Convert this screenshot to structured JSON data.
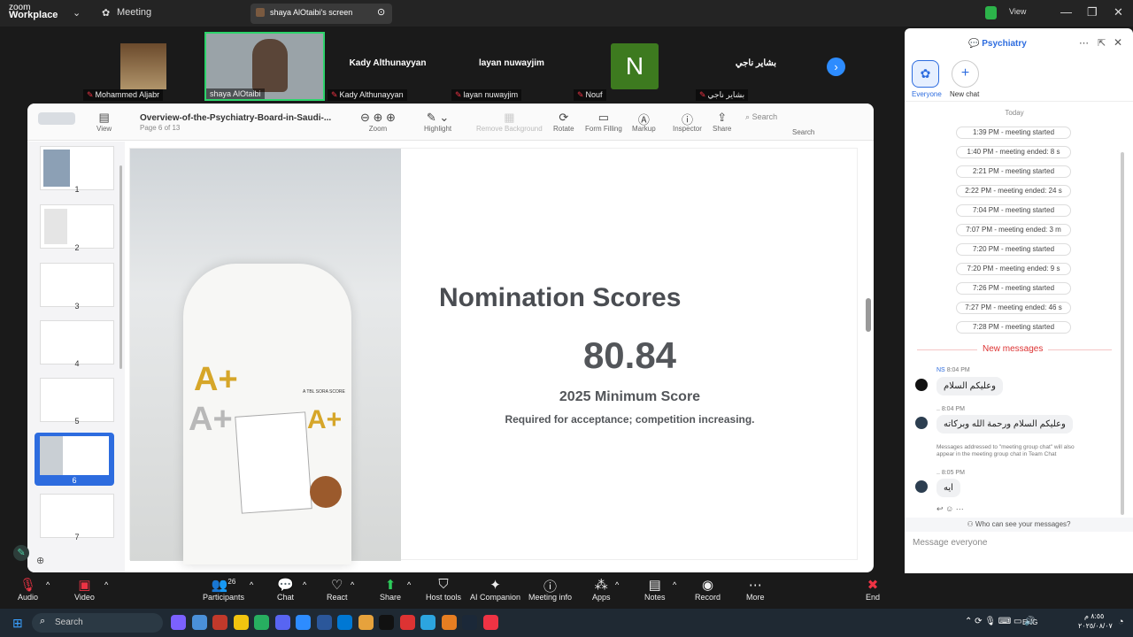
{
  "topbar": {
    "logo_top": "zoom",
    "logo_bottom": "Workplace",
    "meeting": "Meeting",
    "screen_tab": "shaya AlOtaibi's screen",
    "view": "View"
  },
  "gallery": {
    "tiles": [
      {
        "name": "Mohammed Aljabr"
      },
      {
        "name": "shaya AlOtaibi"
      },
      {
        "name": "Kady Althunayyan",
        "label": "Kady Althunayyan"
      },
      {
        "name": "layan nuwayjim",
        "label": "layan nuwayjim"
      },
      {
        "name": "Nouf",
        "initial": "N"
      },
      {
        "name": "بشاير ناجي",
        "label": "بشاير ناجي"
      }
    ]
  },
  "viewer": {
    "doc_title": "Overview-of-the-Psychiatry-Board-in-Saudi-...",
    "page_info": "Page 6 of 13",
    "tools": {
      "view": "View",
      "zoom": "Zoom",
      "highlight": "Highlight",
      "remove_bg": "Remove Background",
      "rotate": "Rotate",
      "form": "Form Filling",
      "markup": "Markup",
      "inspector": "Inspector",
      "share": "Share",
      "search": "Search",
      "search_ph": "Search"
    },
    "thumbs": [
      "1",
      "2",
      "3",
      "4",
      "5",
      "6",
      "7"
    ],
    "slide": {
      "title": "Nomination Scores",
      "score": "80.84",
      "subtitle": "2025 Minimum Score",
      "desc": "Required for acceptance; competition increasing.",
      "coat_text": "A TBL SORA SCORE",
      "grade": "A+"
    }
  },
  "chat": {
    "title": "Psychiatry",
    "everyone": "Everyone",
    "new_chat": "New chat",
    "today": "Today",
    "system": [
      "1:39 PM - meeting started",
      "1:40 PM - meeting ended: 8 s",
      "2:21 PM - meeting started",
      "2:22 PM - meeting ended: 24 s",
      "7:04 PM - meeting started",
      "7:07 PM - meeting ended: 3 m",
      "7:20 PM - meeting started",
      "7:20 PM - meeting ended: 9 s",
      "7:26 PM - meeting started",
      "7:27 PM - meeting ended: 46 s",
      "7:28 PM - meeting started"
    ],
    "new_messages": "New messages",
    "msg1": {
      "sender": "NS",
      "time": "8:04 PM",
      "text": "وعليكم السلام"
    },
    "msg2": {
      "sender": "..",
      "time": "8:04 PM",
      "text": "وعليكم السلام ورحمة الله وبركاته"
    },
    "note": "Messages addressed to \"meeting group chat\" will also appear in the meeting group chat in Team Chat",
    "msg3": {
      "sender": "..",
      "time": "8:05 PM",
      "text": "ايه"
    },
    "who": "Who can see your messages?",
    "input_ph": "Message everyone"
  },
  "bottombar": {
    "audio": "Audio",
    "video": "Video",
    "participants": "Participants",
    "participants_count": "26",
    "chat": "Chat",
    "react": "React",
    "share": "Share",
    "host": "Host tools",
    "ai": "AI Companion",
    "info": "Meeting info",
    "apps": "Apps",
    "notes": "Notes",
    "record": "Record",
    "more": "More",
    "end": "End"
  },
  "taskbar": {
    "search": "Search",
    "lang": "ENG",
    "time": "٨:٥٥ م",
    "date": "٢٠٢٥/٠٨/٠٧"
  }
}
